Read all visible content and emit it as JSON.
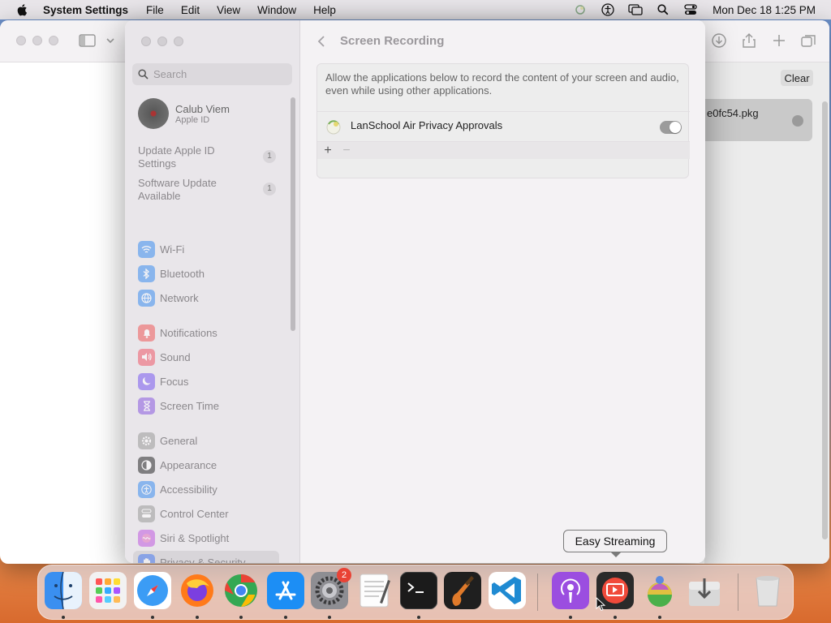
{
  "menubar": {
    "app_name": "System Settings",
    "menus": [
      "File",
      "Edit",
      "View",
      "Window",
      "Help"
    ],
    "clock": "Mon Dec 18  1:25 PM"
  },
  "background_window": {
    "clear_label": "Clear",
    "download_filename": "e0fc54.pkg"
  },
  "settings": {
    "search_placeholder": "Search",
    "account": {
      "name": "Calub Viem",
      "subtitle": "Apple ID"
    },
    "notices": [
      {
        "label": "Update Apple ID Settings",
        "count": "1"
      },
      {
        "label": "Software Update Available",
        "count": "1"
      }
    ],
    "nav": [
      {
        "label": "Wi-Fi",
        "icon": "wifi-icon",
        "color": "#3b8ef0"
      },
      {
        "label": "Bluetooth",
        "icon": "bluetooth-icon",
        "color": "#3b8ef0"
      },
      {
        "label": "Network",
        "icon": "globe-icon",
        "color": "#3b8ef0"
      },
      {
        "label": "Notifications",
        "icon": "bell-icon",
        "color": "#f05a5a"
      },
      {
        "label": "Sound",
        "icon": "speaker-icon",
        "color": "#f05a6a"
      },
      {
        "label": "Focus",
        "icon": "moon-icon",
        "color": "#7a5af0"
      },
      {
        "label": "Screen Time",
        "icon": "hourglass-icon",
        "color": "#8a5ae0"
      },
      {
        "label": "General",
        "icon": "gear-icon",
        "color": "#9a9a9a"
      },
      {
        "label": "Appearance",
        "icon": "appearance-icon",
        "color": "#2a2a2a"
      },
      {
        "label": "Accessibility",
        "icon": "accessibility-icon",
        "color": "#3b8ef0"
      },
      {
        "label": "Control Center",
        "icon": "control-center-icon",
        "color": "#9a9a9a"
      },
      {
        "label": "Siri & Spotlight",
        "icon": "siri-icon",
        "color": "#c05ae0"
      },
      {
        "label": "Privacy & Security",
        "icon": "hand-icon",
        "color": "#4a7af0"
      }
    ],
    "selected_nav": "Privacy & Security",
    "page_title": "Screen Recording",
    "description": "Allow the applications below to record the content of your screen and audio, even while using other applications.",
    "apps": [
      {
        "name": "LanSchool Air Privacy Approvals",
        "enabled": false
      }
    ],
    "add_label": "+",
    "remove_label": "−"
  },
  "dock": {
    "tooltip": "Easy Streaming",
    "apps": [
      {
        "name": "Finder",
        "icon": "finder-icon",
        "running": true
      },
      {
        "name": "Launchpad",
        "icon": "launchpad-icon",
        "running": false
      },
      {
        "name": "Safari",
        "icon": "safari-icon",
        "running": true
      },
      {
        "name": "Firefox",
        "icon": "firefox-icon",
        "running": true
      },
      {
        "name": "Chrome",
        "icon": "chrome-icon",
        "running": true
      },
      {
        "name": "App Store",
        "icon": "app-store-icon",
        "running": true
      },
      {
        "name": "System Settings",
        "icon": "system-settings-icon",
        "running": true,
        "badge": "2"
      },
      {
        "name": "TextEdit",
        "icon": "textedit-icon",
        "running": false
      },
      {
        "name": "Terminal",
        "icon": "terminal-icon",
        "running": true
      },
      {
        "name": "GarageBand",
        "icon": "garageband-icon",
        "running": false
      },
      {
        "name": "Visual Studio Code",
        "icon": "vscode-icon",
        "running": false
      },
      {
        "name": "Podcasts",
        "icon": "podcasts-icon",
        "running": true
      },
      {
        "name": "Easy Streaming",
        "icon": "easy-streaming-icon",
        "running": true
      },
      {
        "name": "Siri Shortcuts",
        "icon": "siri-app-icon",
        "running": true
      },
      {
        "name": "Downloads",
        "icon": "downloads-icon",
        "running": false
      },
      {
        "name": "Trash",
        "icon": "trash-icon",
        "running": false
      }
    ]
  }
}
